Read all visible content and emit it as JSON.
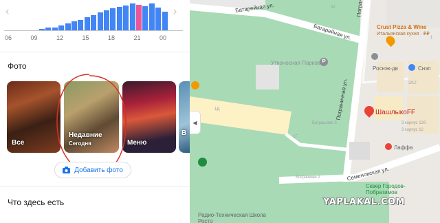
{
  "popular_times": {
    "hours": [
      "06",
      "09",
      "12",
      "15",
      "18",
      "21",
      "00"
    ],
    "bars": [
      0,
      0,
      0,
      0,
      0,
      0.05,
      0.08,
      0.1,
      0.17,
      0.23,
      0.3,
      0.35,
      0.43,
      0.51,
      0.6,
      0.66,
      0.72,
      0.77,
      0.82,
      0.88,
      0.85,
      0.8,
      0.88,
      0.75,
      0.62
    ],
    "highlight_index": 20,
    "prev_arrow": "‹",
    "next_arrow": "›"
  },
  "photos": {
    "title": "Фото",
    "items": [
      {
        "label": "Все",
        "sub": ""
      },
      {
        "label": "Недавние",
        "sub": "Сегодня"
      },
      {
        "label": "Меню",
        "sub": ""
      },
      {
        "label": "В",
        "sub": ""
      }
    ],
    "add_button": "Добавить фото"
  },
  "whats_here": {
    "title": "Что здесь есть"
  },
  "map": {
    "streets": [
      "Батарейная ул.",
      "Батарейная ул.",
      "Пограничная ул.",
      "Пограничная ул.",
      "Семеновская ул."
    ],
    "places": [
      {
        "name": "Утконосная Парковая",
        "color": "#8b8f94"
      },
      {
        "name": "Crust Pizza & Wine",
        "color": "#d56e0c"
      },
      {
        "name": "Итальянская кухня · ₽₽",
        "color": "#b06a2a"
      },
      {
        "name": "Роснэк-дв",
        "color": "#5f6368"
      },
      {
        "name": "Снэп",
        "color": "#5f6368"
      },
      {
        "name": "ШашлыкоFF",
        "color": "#c5221f"
      },
      {
        "name": "Лаффа",
        "color": "#5f6368"
      },
      {
        "name": "Сквер Городов-Побратимов",
        "color": "#1e8e3e"
      },
      {
        "name": "Радио-Техническая Школа Росто",
        "color": "#5f6368"
      }
    ],
    "numbers": [
      "32",
      "1Д",
      "1Г",
      "Бограшове 3",
      "Бограшове 2",
      "3/12",
      "3 корпус 12б",
      "3 корпус 12",
      "1"
    ],
    "collapse_icon": "◀",
    "watermark": "YAPLAKAL.COM",
    "colors": {
      "park": "#a8dab5",
      "road": "#ffffff",
      "building": "#fdf1c6",
      "pin_red": "#ea4335"
    }
  }
}
